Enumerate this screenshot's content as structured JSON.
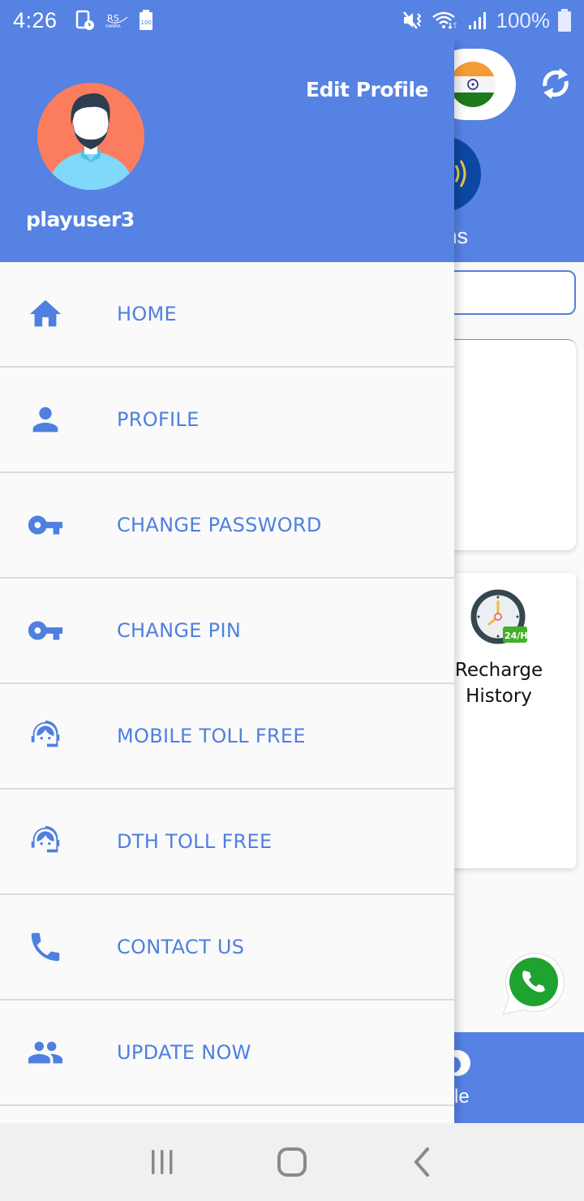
{
  "status_bar": {
    "time": "4:26",
    "battery_percent": "100%",
    "notification_icons": [
      "screen-timer-icon",
      "ros-hanma-icon",
      "battery-100-icon"
    ],
    "system_icons": [
      "mute-vibrate-icon",
      "wifi-icon",
      "signal-icon",
      "battery-icon"
    ]
  },
  "drawer": {
    "username": "playuser3",
    "edit_profile_label": "Edit Profile",
    "items": [
      {
        "label": "HOME",
        "icon": "home-icon"
      },
      {
        "label": "PROFILE",
        "icon": "person-icon"
      },
      {
        "label": "CHANGE PASSWORD",
        "icon": "key-icon"
      },
      {
        "label": "CHANGE PIN",
        "icon": "key-icon"
      },
      {
        "label": "MOBILE TOLL FREE",
        "icon": "support-agent-icon"
      },
      {
        "label": "DTH TOLL FREE",
        "icon": "support-agent-icon"
      },
      {
        "label": "CONTACT US",
        "icon": "phone-icon"
      },
      {
        "label": "UPDATE NOW",
        "icon": "group-icon"
      }
    ]
  },
  "background_app": {
    "notifications_label_partial": "tions",
    "recharge_history_label": "Recharge History",
    "history_badge": "24/H",
    "bottom_nav_label_partial": "file"
  },
  "colors": {
    "primary": "#5582e3",
    "menu_text": "#4f7fe0",
    "drawer_bg": "#fafafa",
    "divider": "#dcdcdc"
  }
}
